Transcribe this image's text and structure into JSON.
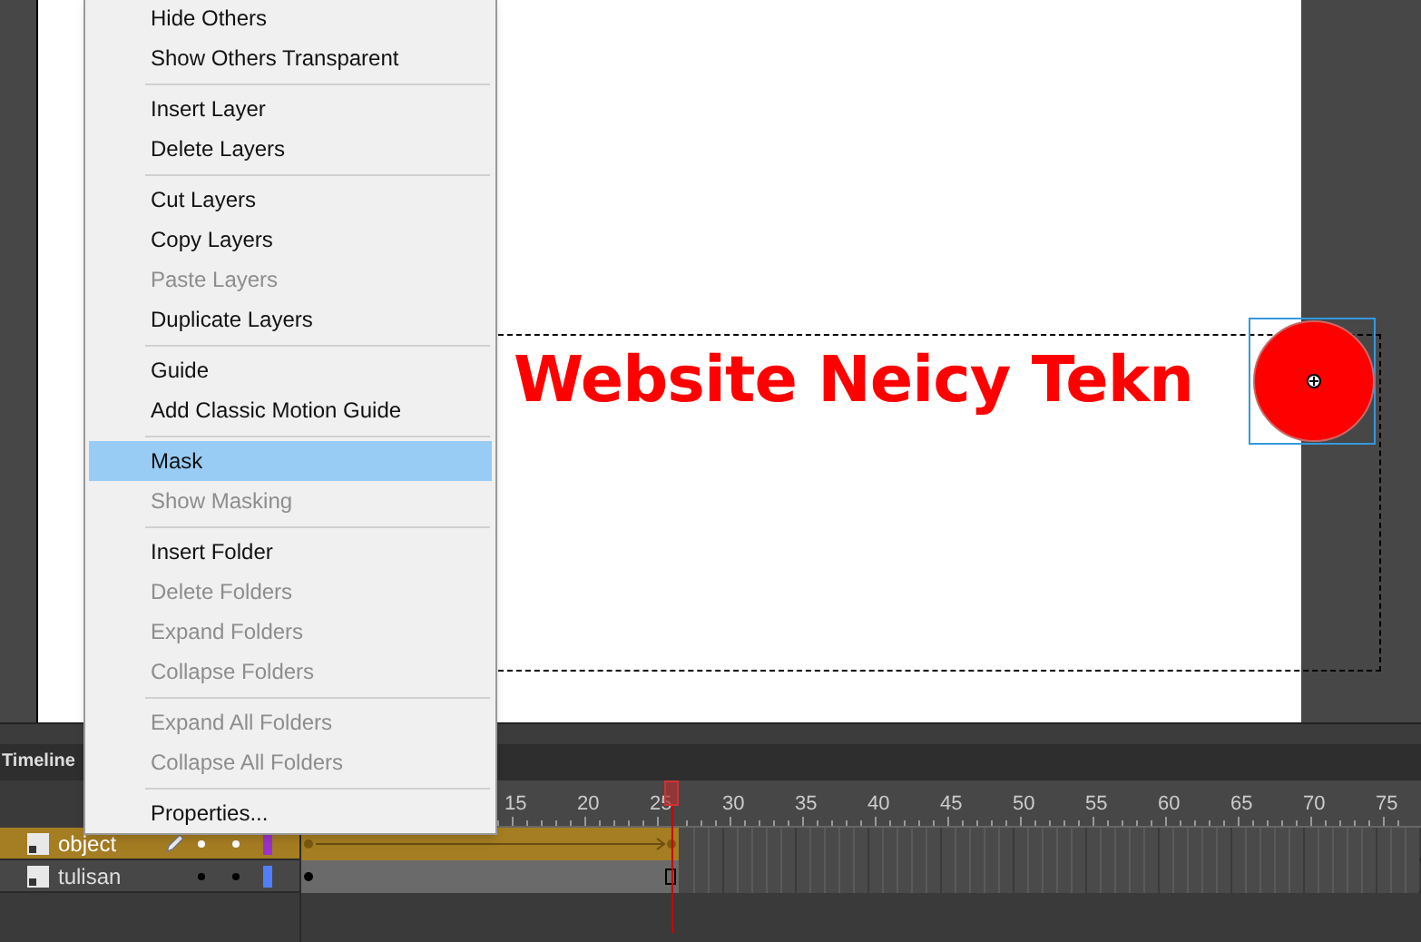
{
  "stage": {
    "text": "Website Neicy Tekn"
  },
  "timeline": {
    "title": "Timeline",
    "ruler": [
      "15",
      "20",
      "25",
      "30",
      "35",
      "40",
      "45",
      "50",
      "55",
      "60",
      "65",
      "70",
      "75"
    ],
    "layers": [
      {
        "name": "object",
        "selected": true,
        "color": "#9933cc",
        "editing": true,
        "tween": true
      },
      {
        "name": "tulisan",
        "selected": false,
        "color": "#4f7fff",
        "editing": false,
        "tween": false
      }
    ]
  },
  "context_menu": {
    "items": [
      {
        "kind": "item",
        "label": "Hide Others",
        "disabled": false,
        "selected": false
      },
      {
        "kind": "item",
        "label": "Show Others Transparent",
        "disabled": false,
        "selected": false
      },
      {
        "kind": "separator"
      },
      {
        "kind": "item",
        "label": "Insert Layer",
        "disabled": false,
        "selected": false
      },
      {
        "kind": "item",
        "label": "Delete Layers",
        "disabled": false,
        "selected": false
      },
      {
        "kind": "separator"
      },
      {
        "kind": "item",
        "label": "Cut Layers",
        "disabled": false,
        "selected": false
      },
      {
        "kind": "item",
        "label": "Copy Layers",
        "disabled": false,
        "selected": false
      },
      {
        "kind": "item",
        "label": "Paste Layers",
        "disabled": true,
        "selected": false
      },
      {
        "kind": "item",
        "label": "Duplicate Layers",
        "disabled": false,
        "selected": false
      },
      {
        "kind": "separator"
      },
      {
        "kind": "item",
        "label": "Guide",
        "disabled": false,
        "selected": false
      },
      {
        "kind": "item",
        "label": "Add Classic Motion Guide",
        "disabled": false,
        "selected": false
      },
      {
        "kind": "separator"
      },
      {
        "kind": "item",
        "label": "Mask",
        "disabled": false,
        "selected": true
      },
      {
        "kind": "item",
        "label": "Show Masking",
        "disabled": true,
        "selected": false
      },
      {
        "kind": "separator"
      },
      {
        "kind": "item",
        "label": "Insert Folder",
        "disabled": false,
        "selected": false
      },
      {
        "kind": "item",
        "label": "Delete Folders",
        "disabled": true,
        "selected": false
      },
      {
        "kind": "item",
        "label": "Expand Folders",
        "disabled": true,
        "selected": false
      },
      {
        "kind": "item",
        "label": "Collapse Folders",
        "disabled": true,
        "selected": false
      },
      {
        "kind": "separator"
      },
      {
        "kind": "item",
        "label": "Expand All Folders",
        "disabled": true,
        "selected": false
      },
      {
        "kind": "item",
        "label": "Collapse All Folders",
        "disabled": true,
        "selected": false
      },
      {
        "kind": "separator"
      },
      {
        "kind": "item",
        "label": "Properties...",
        "disabled": false,
        "selected": false
      }
    ]
  }
}
